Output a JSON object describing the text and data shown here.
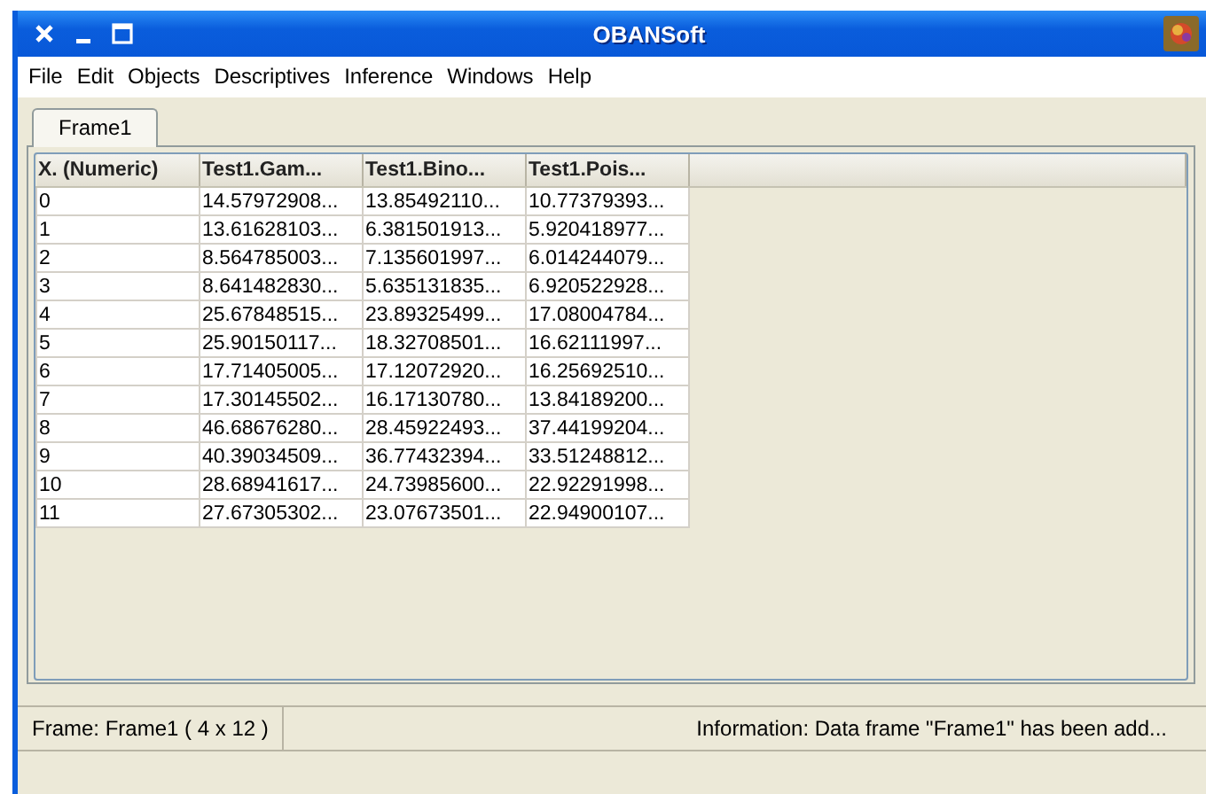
{
  "window": {
    "title": "OBANSoft"
  },
  "menu": [
    "File",
    "Edit",
    "Objects",
    "Descriptives",
    "Inference",
    "Windows",
    "Help"
  ],
  "tabs": [
    {
      "label": "Frame1",
      "selected": true
    }
  ],
  "table": {
    "columns": [
      "X. (Numeric)",
      "Test1.Gam...",
      "Test1.Bino...",
      "Test1.Pois..."
    ],
    "rows": [
      [
        "0",
        "14.57972908...",
        "13.85492110...",
        "10.77379393..."
      ],
      [
        "1",
        "13.61628103...",
        "6.381501913...",
        "5.920418977..."
      ],
      [
        "2",
        "8.564785003...",
        "7.135601997...",
        "6.014244079..."
      ],
      [
        "3",
        "8.641482830...",
        "5.635131835...",
        "6.920522928..."
      ],
      [
        "4",
        "25.67848515...",
        "23.89325499...",
        "17.08004784..."
      ],
      [
        "5",
        "25.90150117...",
        "18.32708501...",
        "16.62111997..."
      ],
      [
        "6",
        "17.71405005...",
        "17.12072920...",
        "16.25692510..."
      ],
      [
        "7",
        "17.30145502...",
        "16.17130780...",
        "13.84189200..."
      ],
      [
        "8",
        "46.68676280...",
        "28.45922493...",
        "37.44199204..."
      ],
      [
        "9",
        "40.39034509...",
        "36.77432394...",
        "33.51248812..."
      ],
      [
        "10",
        "28.68941617...",
        "24.73985600...",
        "22.92291998..."
      ],
      [
        "11",
        "27.67305302...",
        "23.07673501...",
        "22.94900107..."
      ]
    ]
  },
  "status_bar": {
    "frame": "Frame:  Frame1  ( 4 x 12 )",
    "information": "Information: Data frame \"Frame1\" has been add..."
  }
}
